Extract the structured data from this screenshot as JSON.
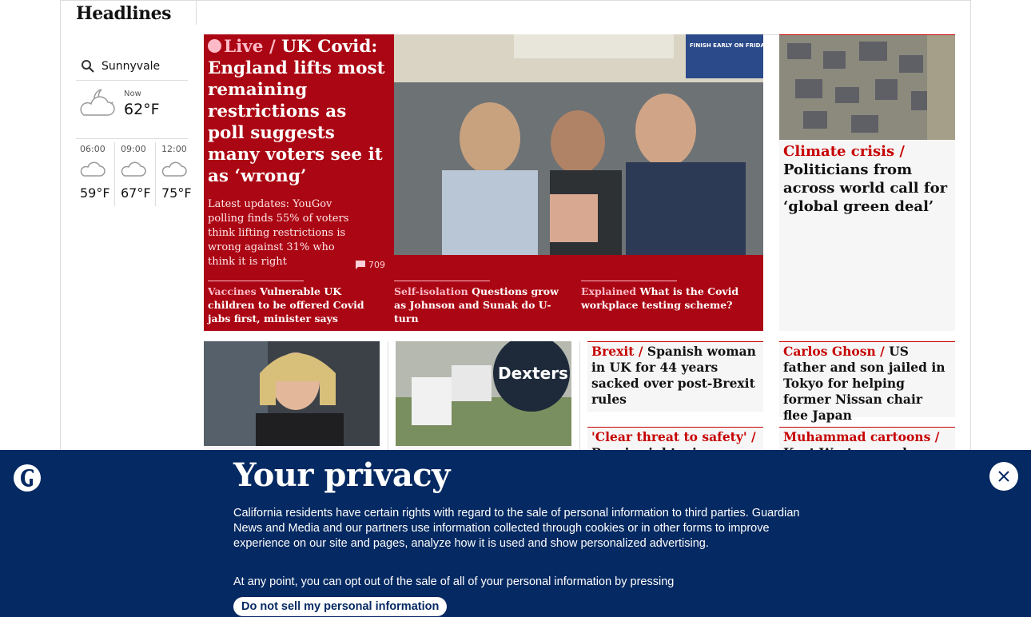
{
  "header": {
    "title": "Headlines"
  },
  "weather": {
    "location": "Sunnyvale",
    "now_label": "Now",
    "now_temp": "62°F",
    "forecast": [
      {
        "time": "06:00",
        "temp": "59°F"
      },
      {
        "time": "09:00",
        "temp": "67°F"
      },
      {
        "time": "12:00",
        "temp": "75°F"
      }
    ]
  },
  "feature": {
    "live_label": "Live /",
    "headline": "UK Covid: England lifts most remaining restrictions as poll suggests many voters see it as ‘wrong’",
    "standfirst": "Latest updates: YouGov polling finds 55% of voters think lifting restrictions is wrong against 31% who think it is right",
    "comment_count": "709",
    "image_sign": "FINISH EARLY ON FRIDAY. IF YOU COULD.",
    "sublinks": [
      {
        "kicker": "Vaccines",
        "text": "Vulnerable UK children to be offered Covid jabs first, minister says"
      },
      {
        "kicker": "Self-isolation",
        "text": "Questions grow as Johnson and Sunak do U-turn"
      },
      {
        "kicker": "Explained",
        "text": "What is the Covid workplace testing scheme?"
      }
    ]
  },
  "climate": {
    "kicker": "Climate crisis /",
    "headline": "Politicians from across world call for ‘global green deal’"
  },
  "cards": [
    {
      "kicker": "Brexit /",
      "headline": "Spanish woman in UK for 44 years sacked over post-Brexit rules"
    },
    {
      "kicker": "Carlos Ghosn /",
      "headline": "US father and son jailed in Tokyo for helping former Nissan chair flee Japan"
    },
    {
      "kicker": "'Clear threat to safety' /",
      "headline": "Russia right-wing ..."
    },
    {
      "kicker": "Muhammad cartoons /",
      "headline": "Kurt Westergaard ..."
    }
  ],
  "estate_sign": "Dexters",
  "privacy": {
    "title": "Your privacy",
    "paragraph1": "California residents have certain rights with regard to the sale of personal information to third parties. Guardian News and Media and our partners use information collected through cookies or in other forms to improve experience on our site and pages, analyze how it is used and show personalized advertising.",
    "paragraph2": "At any point, you can opt out of the sale of all of your personal information by pressing",
    "button": "Do not sell my personal information"
  },
  "colors": {
    "brand_navy": "#052962",
    "news_red": "#c70000",
    "live_red": "#ab0613"
  }
}
